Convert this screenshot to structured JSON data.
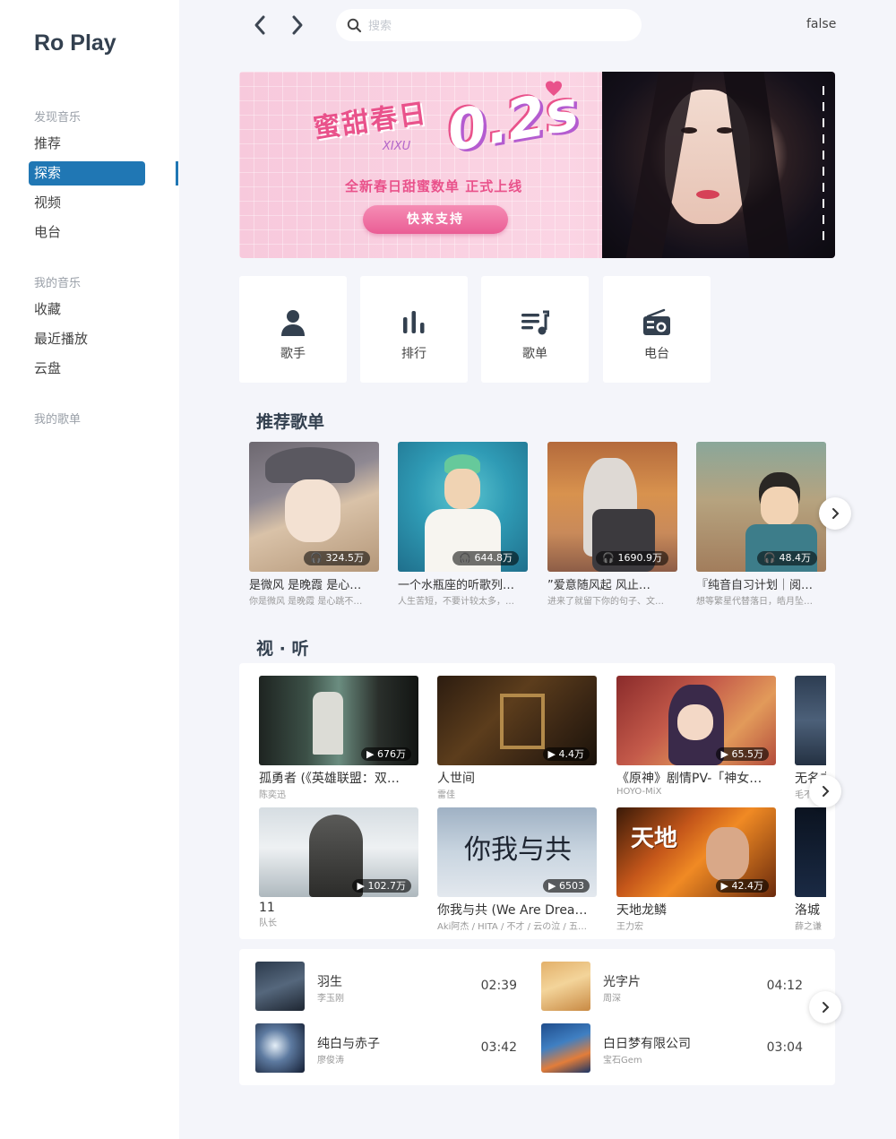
{
  "app": {
    "name": "Ro Play"
  },
  "sidebar": {
    "sections": [
      {
        "heading": "发现音乐",
        "items": [
          {
            "label": "推荐",
            "active": false
          },
          {
            "label": "探索",
            "active": true
          },
          {
            "label": "视频",
            "active": false
          },
          {
            "label": "电台",
            "active": false
          }
        ]
      },
      {
        "heading": "我的音乐",
        "items": [
          {
            "label": "收藏"
          },
          {
            "label": "最近播放"
          },
          {
            "label": "云盘"
          }
        ]
      },
      {
        "heading": "我的歌单",
        "items": []
      }
    ],
    "accent_color": "#2077b4"
  },
  "topbar": {
    "search_placeholder": "搜索",
    "user_status": "false"
  },
  "banner": {
    "logo_text": "蜜甜春日",
    "logo_sub": "XIXU",
    "big_text": "0.2s",
    "headline": "全新春日甜蜜数单 正式上线",
    "cta_label": "快来支持"
  },
  "quick_links": [
    {
      "label": "歌手",
      "icon": "person-icon"
    },
    {
      "label": "排行",
      "icon": "bar-chart-icon"
    },
    {
      "label": "歌单",
      "icon": "playlist-icon"
    },
    {
      "label": "电台",
      "icon": "radio-icon"
    }
  ],
  "playlists_section": {
    "title": "推荐歌单",
    "items": [
      {
        "count": "324.5万",
        "title": "是微风 是晚霞 是心…",
        "desc": "你是微风 是晚霞 是心跳不…"
      },
      {
        "count": "644.8万",
        "title": "一个水瓶座的听歌列…",
        "desc": "人生苦短，不要计较太多，…"
      },
      {
        "count": "1690.9万",
        "title": "”爱意随风起 风止…",
        "desc": "进来了就留下你的句子、文…"
      },
      {
        "count": "48.4万",
        "title": "『纯音自习计划｜阅…",
        "desc": "想等繁星代替落日，皓月坠…"
      }
    ]
  },
  "videos_section": {
    "title": "视 · 听",
    "items": [
      {
        "count": "676万",
        "title": "孤勇者 (《英雄联盟：双…",
        "artist": "陈奕迅"
      },
      {
        "count": "4.4万",
        "title": "人世间",
        "artist": "雷佳"
      },
      {
        "count": "65.5万",
        "title": "《原神》剧情PV-「神女…",
        "artist": "HOYO-MiX"
      },
      {
        "count": "",
        "title": "无名之辈",
        "artist": "毛不易"
      },
      {
        "count": "102.7万",
        "title": "11",
        "artist": "队长"
      },
      {
        "count": "6503",
        "title": "你我与共 (We Are Drea…",
        "artist": "Aki阿杰 / HITA / 不才 / 云の泣 / 五…"
      },
      {
        "count": "42.4万",
        "title": "天地龙鳞",
        "artist": "王力宏"
      },
      {
        "count": "",
        "title": "洛城",
        "artist": "薛之谦"
      }
    ]
  },
  "songs": [
    {
      "title": "羽生",
      "artist": "李玉刚",
      "duration": "02:39"
    },
    {
      "title": "光字片",
      "artist": "周深",
      "duration": "04:12"
    },
    {
      "title": "纯白与赤子",
      "artist": "廖俊涛",
      "duration": "03:42"
    },
    {
      "title": "白日梦有限公司",
      "artist": "宝石Gem",
      "duration": "03:04"
    }
  ]
}
